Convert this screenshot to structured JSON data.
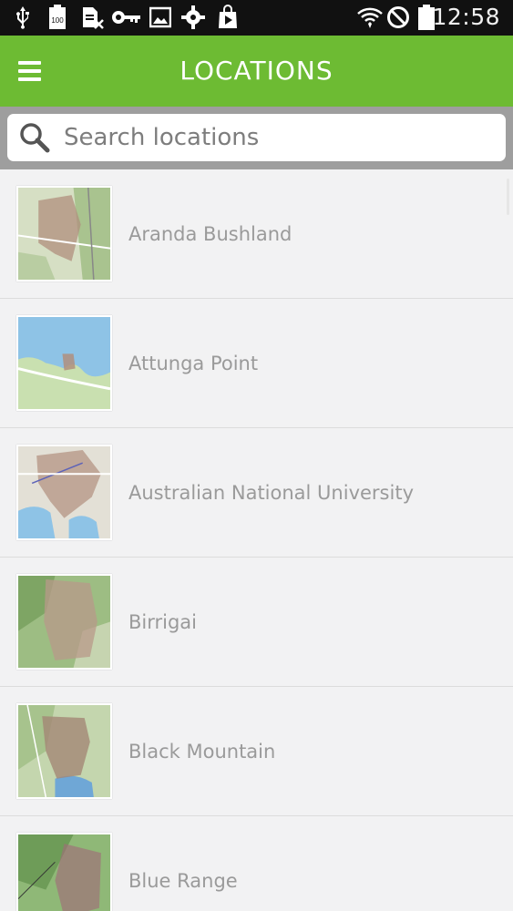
{
  "status_bar": {
    "time": "12:58",
    "icons": [
      "usb-icon",
      "battery-100-icon",
      "sim-card-icon",
      "key-icon",
      "image-icon",
      "settings-icon",
      "play-store-icon",
      "wifi-icon",
      "blocked-icon",
      "battery-icon"
    ],
    "battery_badge": "100"
  },
  "app_bar": {
    "title": "LOCATIONS",
    "menu_icon": "hamburger-menu-icon",
    "color": "#6dbb33"
  },
  "search": {
    "placeholder": "Search locations",
    "value": ""
  },
  "locations": [
    {
      "label": "Aranda Bushland"
    },
    {
      "label": "Attunga Point"
    },
    {
      "label": "Australian National University"
    },
    {
      "label": "Birrigai"
    },
    {
      "label": "Black Mountain"
    },
    {
      "label": "Blue Range"
    }
  ]
}
